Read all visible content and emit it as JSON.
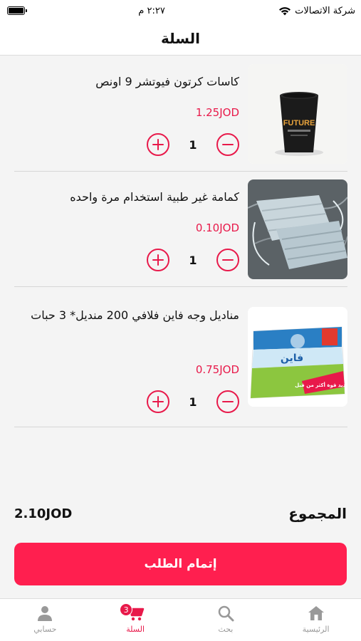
{
  "status_bar": {
    "time": "٢:٢٧ م",
    "carrier": "شركة الاتصالات"
  },
  "header": {
    "title": "السلة"
  },
  "cart": {
    "items": [
      {
        "name": "كاسات كرتون فيوتشر 9 اونص",
        "price": "1.25JOD",
        "quantity": "1"
      },
      {
        "name": "كمامة غير طبية استخدام مرة واحده",
        "price": "0.10JOD",
        "quantity": "1"
      },
      {
        "name": "مناديل وجه فاين فلافي 200 منديل* 3 حبات",
        "price": "0.75JOD",
        "quantity": "1"
      }
    ]
  },
  "product_images": {
    "cup_brand": "FUTURE",
    "tissue_brand": "فاين",
    "tissue_badge": "جديد قوة أكثر من قبل!"
  },
  "total": {
    "label": "المجموع",
    "amount": "2.10JOD"
  },
  "checkout": {
    "label": "إتمام الطلب"
  },
  "tabs": [
    {
      "label": "حسابي",
      "icon": "person-icon"
    },
    {
      "label": "السلة",
      "icon": "cart-icon",
      "badge": "3",
      "active": true
    },
    {
      "label": "بحث",
      "icon": "search-icon"
    },
    {
      "label": "الرئيسية",
      "icon": "home-icon"
    }
  ],
  "colors": {
    "accent": "#e8194a",
    "button": "#ff1f4f"
  }
}
